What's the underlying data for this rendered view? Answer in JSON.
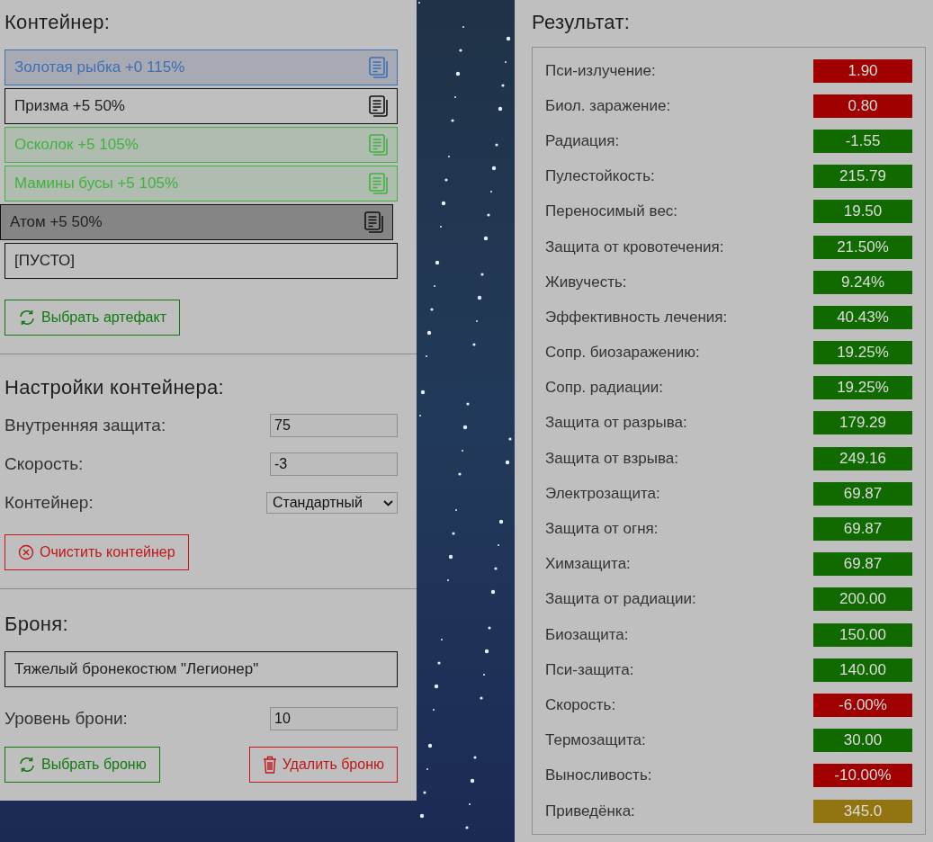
{
  "container": {
    "title": "Контейнер:",
    "slots": [
      {
        "label": "Золотая рыбка +0 115%",
        "kind": "active"
      },
      {
        "label": "Призма +5 50%",
        "kind": "plain"
      },
      {
        "label": "Осколок +5 105%",
        "kind": "boosted"
      },
      {
        "label": "Мамины бусы +5 105%",
        "kind": "boosted"
      },
      {
        "label": "Атом +5 50%",
        "kind": "hovered"
      },
      {
        "label": "[ПУСТО]",
        "kind": "empty"
      }
    ],
    "pick_button": "Выбрать артефакт"
  },
  "settings": {
    "title": "Настройки контейнера:",
    "fields": [
      {
        "label": "Внутренняя защита:",
        "value": "75",
        "kind": "input"
      },
      {
        "label": "Скорость:",
        "value": "-3",
        "kind": "input"
      },
      {
        "label": "Контейнер:",
        "value": "Стандартный",
        "kind": "select"
      }
    ],
    "clear_button": "Очистить контейнер"
  },
  "armor": {
    "title": "Броня:",
    "name": "Тяжелый бронекостюм \"Легионер\"",
    "level_label": "Уровень брони:",
    "level_value": "10",
    "pick_button": "Выбрать броню",
    "delete_button": "Удалить броню"
  },
  "result": {
    "title": "Результат:",
    "stats": [
      {
        "label": "Пси-излучение:",
        "value": "1.90",
        "color": "#a00000"
      },
      {
        "label": "Биол. заражение:",
        "value": "0.80",
        "color": "#a00000"
      },
      {
        "label": "Радиация:",
        "value": "-1.55",
        "color": "#106a00"
      },
      {
        "label": "Пулестойкость:",
        "value": "215.79",
        "color": "#106a00"
      },
      {
        "label": "Переносимый вес:",
        "value": "19.50",
        "color": "#106a00"
      },
      {
        "label": "Защита от кровотечения:",
        "value": "21.50%",
        "color": "#106a00"
      },
      {
        "label": "Живучесть:",
        "value": "9.24%",
        "color": "#106a00"
      },
      {
        "label": "Эффективность лечения:",
        "value": "40.43%",
        "color": "#106a00"
      },
      {
        "label": "Сопр. биозаражению:",
        "value": "19.25%",
        "color": "#106a00"
      },
      {
        "label": "Сопр. радиации:",
        "value": "19.25%",
        "color": "#106a00"
      },
      {
        "label": "Защита от разрыва:",
        "value": "179.29",
        "color": "#106a00"
      },
      {
        "label": "Защита от взрыва:",
        "value": "249.16",
        "color": "#106a00"
      },
      {
        "label": "Электрозащита:",
        "value": "69.87",
        "color": "#106a00"
      },
      {
        "label": "Защита от огня:",
        "value": "69.87",
        "color": "#106a00"
      },
      {
        "label": "Химзащита:",
        "value": "69.87",
        "color": "#106a00"
      },
      {
        "label": "Защита от радиации:",
        "value": "200.00",
        "color": "#106a00"
      },
      {
        "label": "Биозащита:",
        "value": "150.00",
        "color": "#106a00"
      },
      {
        "label": "Пси-защита:",
        "value": "140.00",
        "color": "#106a00"
      },
      {
        "label": "Скорость:",
        "value": "-6.00%",
        "color": "#a00000"
      },
      {
        "label": "Термозащита:",
        "value": "30.00",
        "color": "#106a00"
      },
      {
        "label": "Выносливость:",
        "value": "-10.00%",
        "color": "#a00000"
      },
      {
        "label": "Приведёнка:",
        "value": "345.0",
        "color": "#927510"
      }
    ]
  }
}
